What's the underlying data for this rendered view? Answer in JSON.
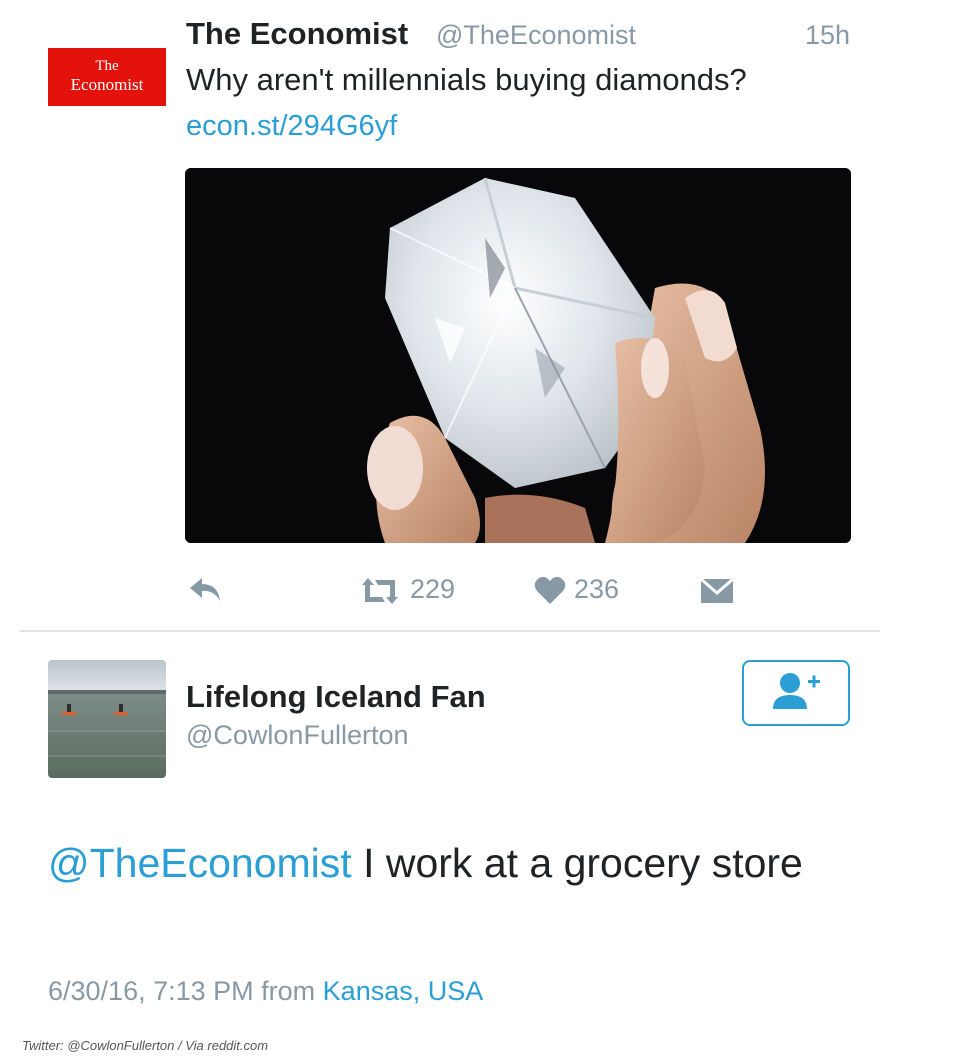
{
  "tweet1": {
    "logo_line1": "The",
    "logo_line2": "Economist",
    "name": "The Economist",
    "handle": "@TheEconomist",
    "time": "15h",
    "text": "Why aren't millennials buying diamonds?",
    "link": "econ.st/294G6yf",
    "retweet_count": "229",
    "like_count": "236"
  },
  "tweet2": {
    "name": "Lifelong Iceland Fan",
    "handle": "@CowlonFullerton",
    "mention": "@TheEconomist",
    "text": " I work at a grocery store",
    "date": "6/30/16, 7:13 PM",
    "from_label": "from",
    "location": "Kansas, USA"
  },
  "credit": "Twitter: @CowlonFullerton / Via reddit.com",
  "colors": {
    "link_blue": "#2b9ed6",
    "muted_gray": "#8899a6",
    "economist_red": "#e3120b"
  }
}
